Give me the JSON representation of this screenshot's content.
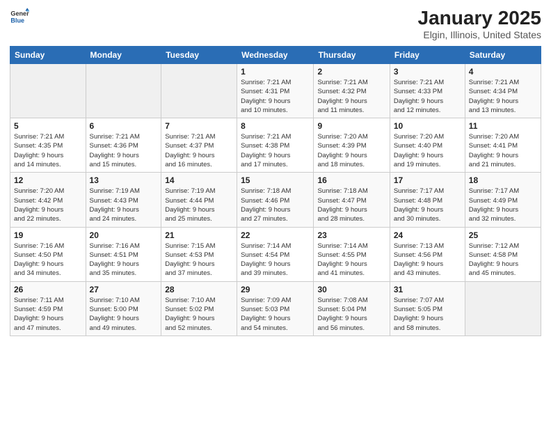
{
  "logo": {
    "line1": "General",
    "line2": "Blue"
  },
  "title": "January 2025",
  "subtitle": "Elgin, Illinois, United States",
  "days_of_week": [
    "Sunday",
    "Monday",
    "Tuesday",
    "Wednesday",
    "Thursday",
    "Friday",
    "Saturday"
  ],
  "weeks": [
    [
      {
        "day": "",
        "info": ""
      },
      {
        "day": "",
        "info": ""
      },
      {
        "day": "",
        "info": ""
      },
      {
        "day": "1",
        "info": "Sunrise: 7:21 AM\nSunset: 4:31 PM\nDaylight: 9 hours\nand 10 minutes."
      },
      {
        "day": "2",
        "info": "Sunrise: 7:21 AM\nSunset: 4:32 PM\nDaylight: 9 hours\nand 11 minutes."
      },
      {
        "day": "3",
        "info": "Sunrise: 7:21 AM\nSunset: 4:33 PM\nDaylight: 9 hours\nand 12 minutes."
      },
      {
        "day": "4",
        "info": "Sunrise: 7:21 AM\nSunset: 4:34 PM\nDaylight: 9 hours\nand 13 minutes."
      }
    ],
    [
      {
        "day": "5",
        "info": "Sunrise: 7:21 AM\nSunset: 4:35 PM\nDaylight: 9 hours\nand 14 minutes."
      },
      {
        "day": "6",
        "info": "Sunrise: 7:21 AM\nSunset: 4:36 PM\nDaylight: 9 hours\nand 15 minutes."
      },
      {
        "day": "7",
        "info": "Sunrise: 7:21 AM\nSunset: 4:37 PM\nDaylight: 9 hours\nand 16 minutes."
      },
      {
        "day": "8",
        "info": "Sunrise: 7:21 AM\nSunset: 4:38 PM\nDaylight: 9 hours\nand 17 minutes."
      },
      {
        "day": "9",
        "info": "Sunrise: 7:20 AM\nSunset: 4:39 PM\nDaylight: 9 hours\nand 18 minutes."
      },
      {
        "day": "10",
        "info": "Sunrise: 7:20 AM\nSunset: 4:40 PM\nDaylight: 9 hours\nand 19 minutes."
      },
      {
        "day": "11",
        "info": "Sunrise: 7:20 AM\nSunset: 4:41 PM\nDaylight: 9 hours\nand 21 minutes."
      }
    ],
    [
      {
        "day": "12",
        "info": "Sunrise: 7:20 AM\nSunset: 4:42 PM\nDaylight: 9 hours\nand 22 minutes."
      },
      {
        "day": "13",
        "info": "Sunrise: 7:19 AM\nSunset: 4:43 PM\nDaylight: 9 hours\nand 24 minutes."
      },
      {
        "day": "14",
        "info": "Sunrise: 7:19 AM\nSunset: 4:44 PM\nDaylight: 9 hours\nand 25 minutes."
      },
      {
        "day": "15",
        "info": "Sunrise: 7:18 AM\nSunset: 4:46 PM\nDaylight: 9 hours\nand 27 minutes."
      },
      {
        "day": "16",
        "info": "Sunrise: 7:18 AM\nSunset: 4:47 PM\nDaylight: 9 hours\nand 28 minutes."
      },
      {
        "day": "17",
        "info": "Sunrise: 7:17 AM\nSunset: 4:48 PM\nDaylight: 9 hours\nand 30 minutes."
      },
      {
        "day": "18",
        "info": "Sunrise: 7:17 AM\nSunset: 4:49 PM\nDaylight: 9 hours\nand 32 minutes."
      }
    ],
    [
      {
        "day": "19",
        "info": "Sunrise: 7:16 AM\nSunset: 4:50 PM\nDaylight: 9 hours\nand 34 minutes."
      },
      {
        "day": "20",
        "info": "Sunrise: 7:16 AM\nSunset: 4:51 PM\nDaylight: 9 hours\nand 35 minutes."
      },
      {
        "day": "21",
        "info": "Sunrise: 7:15 AM\nSunset: 4:53 PM\nDaylight: 9 hours\nand 37 minutes."
      },
      {
        "day": "22",
        "info": "Sunrise: 7:14 AM\nSunset: 4:54 PM\nDaylight: 9 hours\nand 39 minutes."
      },
      {
        "day": "23",
        "info": "Sunrise: 7:14 AM\nSunset: 4:55 PM\nDaylight: 9 hours\nand 41 minutes."
      },
      {
        "day": "24",
        "info": "Sunrise: 7:13 AM\nSunset: 4:56 PM\nDaylight: 9 hours\nand 43 minutes."
      },
      {
        "day": "25",
        "info": "Sunrise: 7:12 AM\nSunset: 4:58 PM\nDaylight: 9 hours\nand 45 minutes."
      }
    ],
    [
      {
        "day": "26",
        "info": "Sunrise: 7:11 AM\nSunset: 4:59 PM\nDaylight: 9 hours\nand 47 minutes."
      },
      {
        "day": "27",
        "info": "Sunrise: 7:10 AM\nSunset: 5:00 PM\nDaylight: 9 hours\nand 49 minutes."
      },
      {
        "day": "28",
        "info": "Sunrise: 7:10 AM\nSunset: 5:02 PM\nDaylight: 9 hours\nand 52 minutes."
      },
      {
        "day": "29",
        "info": "Sunrise: 7:09 AM\nSunset: 5:03 PM\nDaylight: 9 hours\nand 54 minutes."
      },
      {
        "day": "30",
        "info": "Sunrise: 7:08 AM\nSunset: 5:04 PM\nDaylight: 9 hours\nand 56 minutes."
      },
      {
        "day": "31",
        "info": "Sunrise: 7:07 AM\nSunset: 5:05 PM\nDaylight: 9 hours\nand 58 minutes."
      },
      {
        "day": "",
        "info": ""
      }
    ]
  ]
}
